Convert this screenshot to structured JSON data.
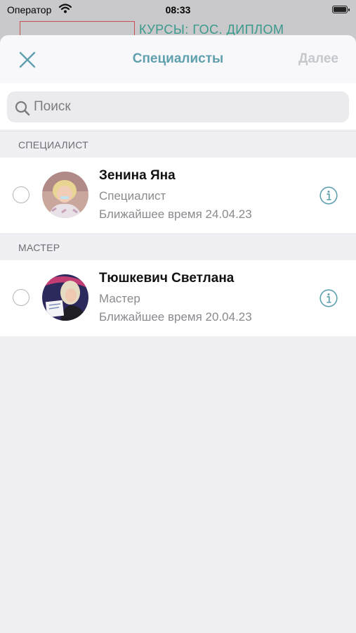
{
  "status_bar": {
    "carrier": "Оператор",
    "time": "08:33"
  },
  "background": {
    "peek_text": "КУРСЫ: ГОС. ДИПЛОМ"
  },
  "nav": {
    "title": "Специалисты",
    "next_label": "Далее",
    "next_enabled": false
  },
  "search": {
    "placeholder": "Поиск",
    "value": ""
  },
  "sections": [
    {
      "header": "СПЕЦИАЛИСТ",
      "items": [
        {
          "name": "Зенина Яна",
          "role": "Специалист",
          "nearest": "Ближайшее время 24.04.23",
          "selected": false
        }
      ]
    },
    {
      "header": "МАСТЕР",
      "items": [
        {
          "name": "Тюшкевич Светлана",
          "role": "Мастер",
          "nearest": "Ближайшее время 20.04.23",
          "selected": false
        }
      ]
    }
  ],
  "colors": {
    "accent": "#5f9fae",
    "disabled": "#c4c8cc",
    "brand_peek": "#3a9a8c"
  },
  "icons": {
    "close": "close-icon",
    "search": "search-icon",
    "info": "info-icon",
    "wifi": "wifi-icon",
    "battery": "battery-icon"
  }
}
